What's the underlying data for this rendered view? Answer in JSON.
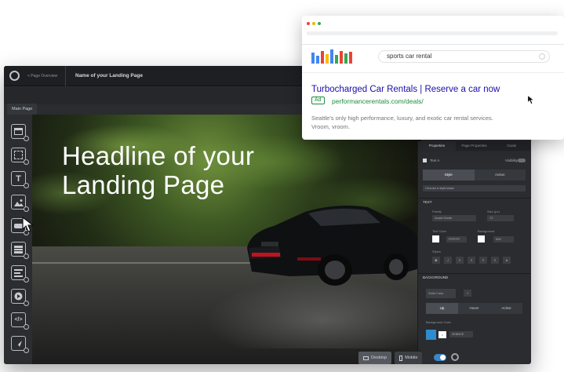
{
  "editor": {
    "back_label": "< Page Overview",
    "page_title": "Name of your Landing Page",
    "main_page_tab": "Main Page",
    "headline": "Headline of your Landing Page",
    "tools": [
      {
        "icon": "section-icon"
      },
      {
        "icon": "box-icon"
      },
      {
        "icon": "text-icon",
        "glyph": "T"
      },
      {
        "icon": "image-icon"
      },
      {
        "icon": "button-icon"
      },
      {
        "icon": "form-icon"
      },
      {
        "icon": "list-icon"
      },
      {
        "icon": "video-icon"
      },
      {
        "icon": "code-icon",
        "glyph": "</>"
      },
      {
        "icon": "social-icon"
      }
    ],
    "devices": {
      "desktop": "Desktop",
      "mobile": "Mobile"
    }
  },
  "panel": {
    "tabs": [
      "Properties",
      "Page Properties",
      "Goals"
    ],
    "layer_label": "Text A",
    "visibility_label": "Visibility",
    "state_tabs": [
      "Style",
      "Action"
    ],
    "style_placeholder": "Choose a style/class",
    "text_section": "TEXT",
    "labels": {
      "font_family": "Family",
      "font_size": "Size (px)",
      "text_color": "Text Color",
      "background": "Background",
      "styles": "Styles"
    },
    "values": {
      "font_family": "Avant Garde",
      "font_size": "72",
      "text_color": "FFFFFF",
      "background": "000"
    },
    "background_section": "BACKGROUND",
    "fill_type": "Solid Color",
    "bg_states": [
      "Up",
      "Hover",
      "Active"
    ],
    "bg_color_label": "Background Color",
    "bg_color_value": "2E8BCE"
  },
  "browser": {
    "search_query": "sports car rental",
    "ad_title": "Turbocharged Car Rentals | Reserve a car now",
    "ad_badge": "Ad",
    "ad_url": "performancerentals.com/deals/",
    "ad_desc_line1": "Seattle's only high performance, luxury, and exotic car rental services.",
    "ad_desc_line2": "Vroom, vroom."
  },
  "colors": {
    "dot_red": "#e8463b",
    "dot_yellow": "#f4b400",
    "dot_green": "#34a853",
    "accent_blue": "#2e8bce",
    "ad_title": "#1a0dab",
    "ad_green": "#1e8e3e"
  }
}
